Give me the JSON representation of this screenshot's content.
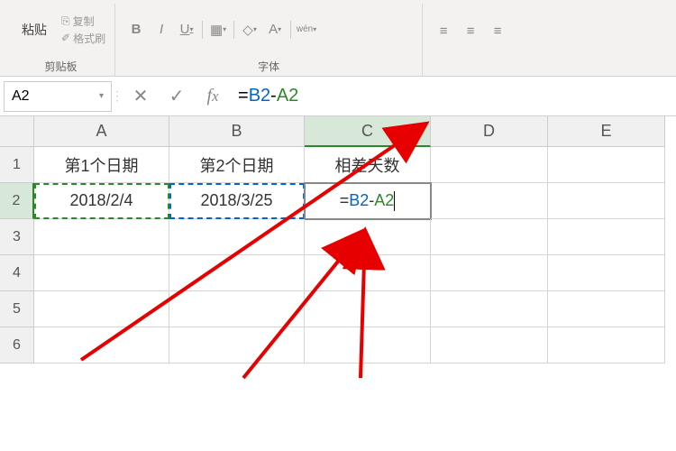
{
  "ribbon": {
    "paste_label": "粘贴",
    "copy_label": "复制",
    "format_painter_label": "格式刷",
    "clipboard_group": "剪贴板",
    "font_group": "字体",
    "bold": "B",
    "italic": "I",
    "underline": "U",
    "font_letter": "A",
    "wen": "wén"
  },
  "formula_bar": {
    "name_box": "A2",
    "formula_prefix": "=",
    "formula_ref1": "B2",
    "formula_op": "-",
    "formula_ref2": "A2"
  },
  "columns": {
    "A": "A",
    "B": "B",
    "C": "C",
    "D": "D",
    "E": "E"
  },
  "rows": {
    "r1": "1",
    "r2": "2",
    "r3": "3",
    "r4": "4",
    "r5": "5",
    "r6": "6"
  },
  "cells": {
    "A1": "第1个日期",
    "B1": "第2个日期",
    "C1": "相差天数",
    "A2": "2018/2/4",
    "B2": "2018/3/25",
    "C2_prefix": "=",
    "C2_ref1": "B2",
    "C2_op": "-",
    "C2_ref2": "A2"
  }
}
